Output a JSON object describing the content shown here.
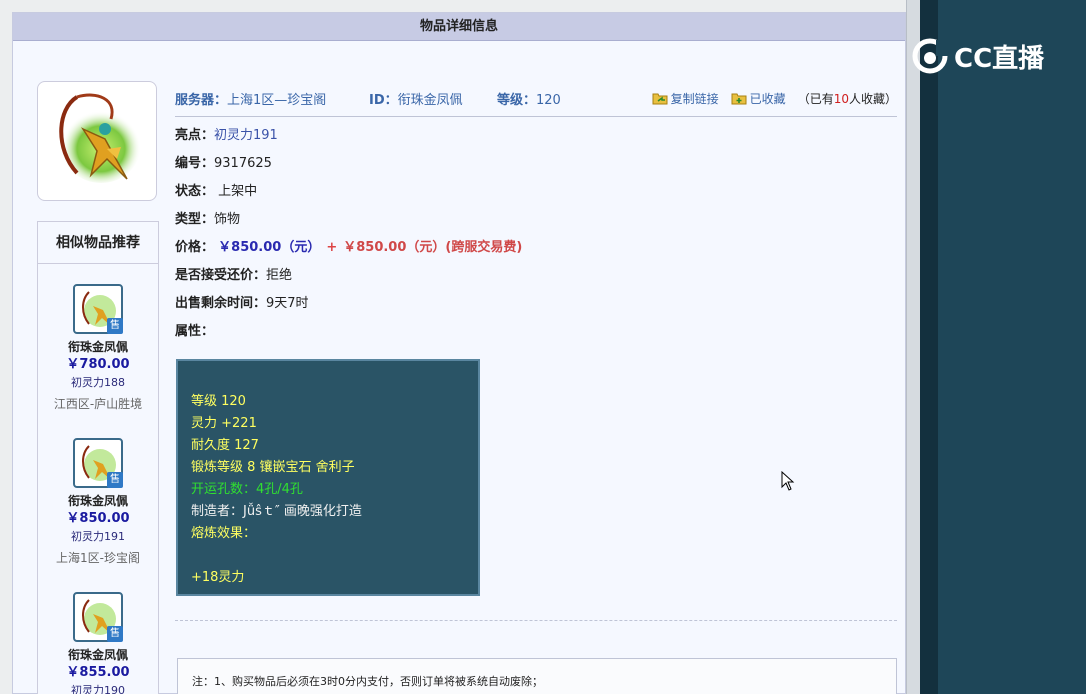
{
  "panel": {
    "title": "物品详细信息"
  },
  "item": {
    "server_label": "服务器：",
    "server": "上海1区—珍宝阁",
    "id_label": "ID：",
    "id": "衔珠金凤佩",
    "level_label": "等级：",
    "level": "120",
    "copy_link": "复制链接",
    "favorited": "已收藏",
    "fav_prefix": "（已有",
    "fav_count": "10",
    "fav_suffix": "人收藏）"
  },
  "fields": {
    "highlight_label": "亮点：",
    "highlight": "初灵力191",
    "number_label": "编号：",
    "number": "9317625",
    "status_label": "状态：",
    "status": "上架中",
    "type_label": "类型：",
    "type": "饰物",
    "price_label": "价格：",
    "price": "￥850.00（元）",
    "price_plus": "+",
    "price_fee": "￥850.00（元）(跨服交易费)",
    "counter_label": "是否接受还价：",
    "counter": "拒绝",
    "remaining_label": "出售剩余时间：",
    "remaining": "9天7时",
    "attrs_label": "属性："
  },
  "attributes": {
    "line1": "等级 120",
    "line2": "灵力 +221",
    "line3": "耐久度 127",
    "line4": "锻炼等级 8 镶嵌宝石 舍利子",
    "line5": "开运孔数：4孔/4孔",
    "line6": "制造者：Jǚŝｔ″ 画晚强化打造",
    "line7": "熔炼效果：",
    "line8": "+18灵力"
  },
  "similar": {
    "title": "相似物品推荐",
    "sale_tag": "售",
    "items": [
      {
        "name": "衔珠金凤佩",
        "price": "￥780.00",
        "attr": "初灵力188",
        "server": "江西区-庐山胜境"
      },
      {
        "name": "衔珠金凤佩",
        "price": "￥850.00",
        "attr": "初灵力191",
        "server": "上海1区-珍宝阁"
      },
      {
        "name": "衔珠金凤佩",
        "price": "￥855.00",
        "attr": "初灵力190",
        "server": ""
      }
    ]
  },
  "notice": {
    "text": "注：1、购买物品后必须在3时0分内支付，否则订单将被系统自动废除；"
  },
  "overlay": {
    "brand": "CC直播"
  }
}
